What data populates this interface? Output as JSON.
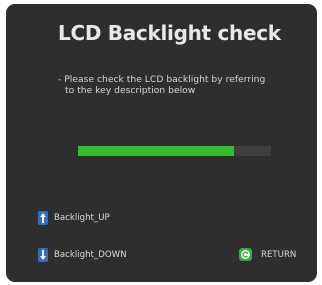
{
  "screen": {
    "title": "LCD Backlight check",
    "description_line1": "- Please check the LCD backlight by referring",
    "description_line2": "to the key description below"
  },
  "progress": {
    "value": 0.81,
    "fill_color": "#32c030",
    "track_color": "#3e3e3e"
  },
  "keys": {
    "up": {
      "label": "Backlight_UP",
      "icon": "arrow-up-key-icon"
    },
    "down": {
      "label": "Backlight_DOWN",
      "icon": "arrow-down-key-icon"
    },
    "return": {
      "label": "RETURN",
      "icon": "return-key-icon"
    }
  },
  "colors": {
    "panel": "#2e2e2e",
    "key_blue": "#2f6fc4",
    "return_green": "#34b03a"
  }
}
